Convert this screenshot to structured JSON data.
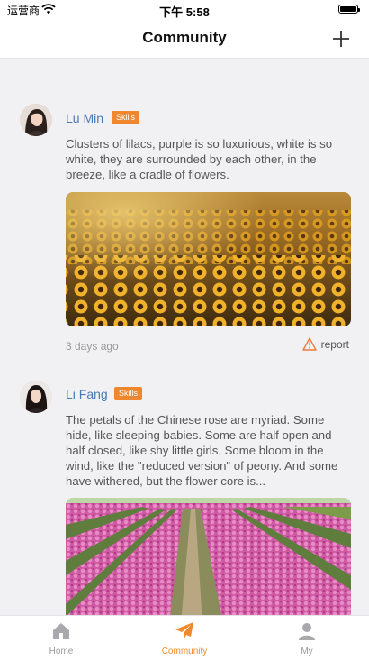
{
  "status_bar": {
    "carrier": "运营商",
    "time": "下午 5:58"
  },
  "header": {
    "title": "Community",
    "add_icon": "plus-icon"
  },
  "posts": [
    {
      "author": "Lu Min",
      "badge": "Skills",
      "text": "Clusters of lilacs, purple is so luxurious, white is so white, they are surrounded by each other, in the breeze, like a cradle of flowers.",
      "time": "3 days ago",
      "report_label": "report",
      "image": "sunflower-field"
    },
    {
      "author": "Li Fang",
      "badge": "Skills",
      "text": "The petals of the Chinese rose are myriad. Some hide, like sleeping babies. Some are half open and half closed, like shy little girls. Some bloom in the wind, like the \"reduced version\" of peony. And some have withered, but the flower core is...",
      "image": "tulip-field"
    }
  ],
  "tabbar": {
    "tabs": [
      {
        "label": "Home",
        "icon": "home-icon"
      },
      {
        "label": "Community",
        "icon": "paper-plane-icon",
        "active": true
      },
      {
        "label": "My",
        "icon": "person-icon"
      }
    ]
  },
  "colors": {
    "accent": "#f08a2c",
    "author": "#4a78b5",
    "badge": "#f0872f",
    "background": "#f1f1f4"
  }
}
